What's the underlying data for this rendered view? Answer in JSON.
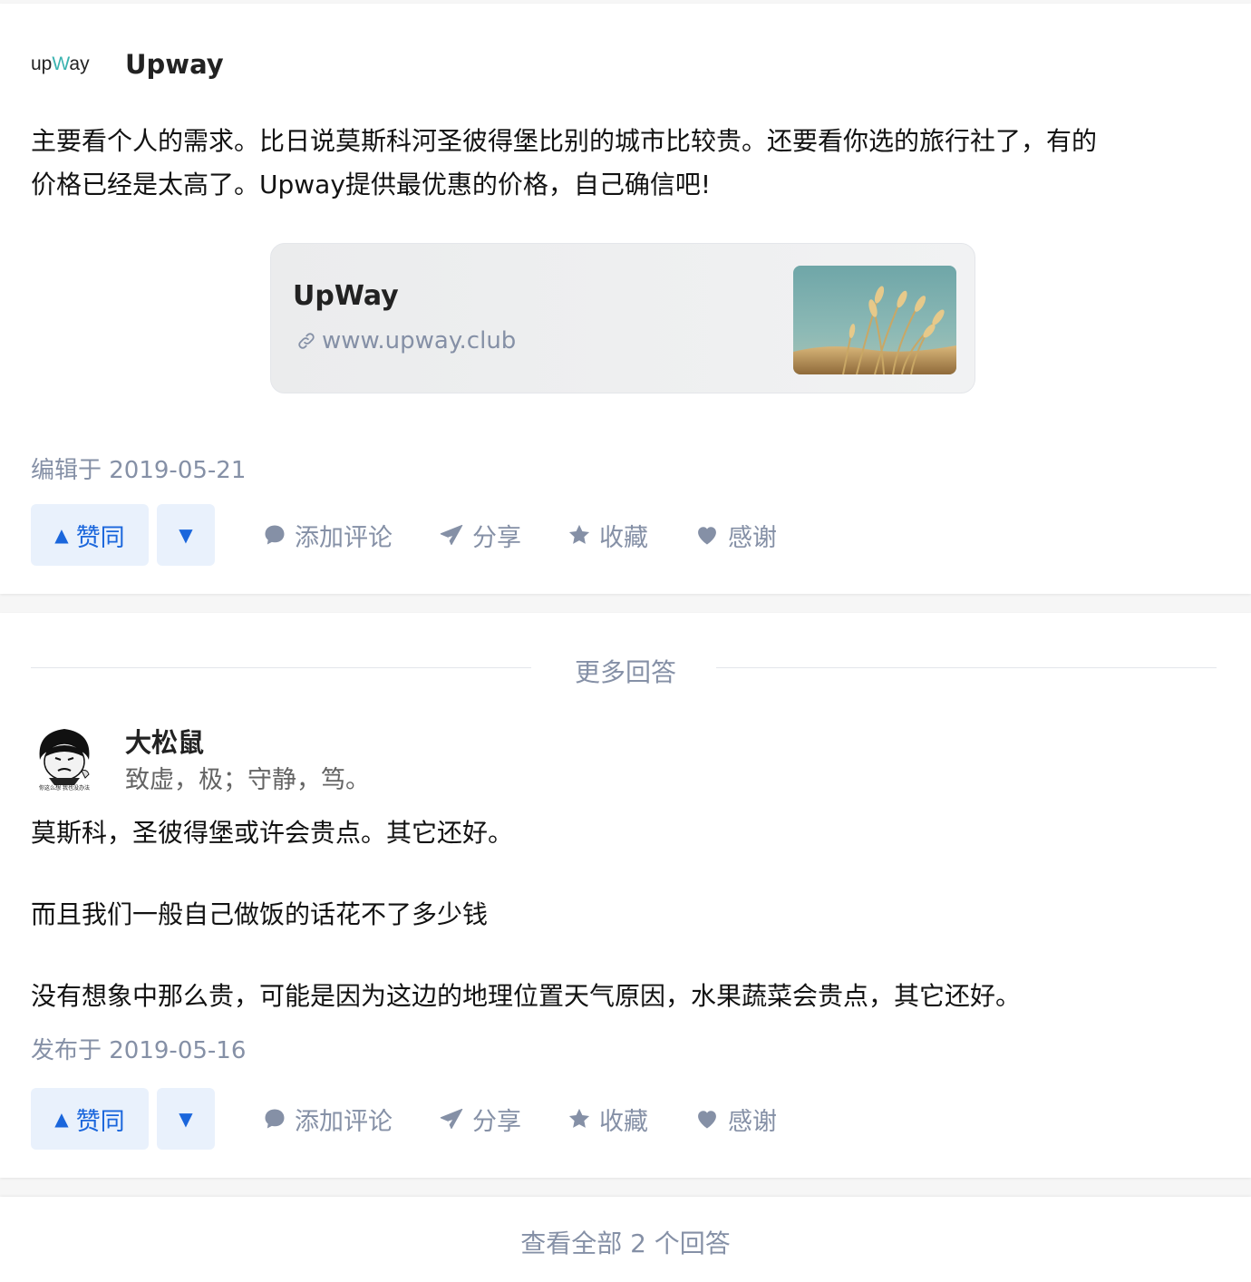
{
  "answer1": {
    "logo_text_left": "up",
    "logo_text_w": "W",
    "logo_text_right": "ay",
    "author_name": "Upway",
    "content_line1": "主要看个人的需求。比日说莫斯科河圣彼得堡比别的城市比较贵。还要看你选的旅行社了，有的",
    "content_line2": "价格已经是太高了。Upway提供最优惠的价格，自己确信吧!",
    "link_card": {
      "title": "UpWay",
      "url": "www.upway.club"
    },
    "meta": "编辑于 2019-05-21",
    "actions": {
      "upvote": "赞同",
      "comment": "添加评论",
      "share": "分享",
      "collect": "收藏",
      "thanks": "感谢"
    }
  },
  "more_answers_label": "更多回答",
  "answer2": {
    "author_name": "大松鼠",
    "author_bio": "致虚，极；守静，笃。",
    "avatar_caption": "你这么想 我也没办法",
    "paragraphs": [
      "莫斯科，圣彼得堡或许会贵点。其它还好。",
      "而且我们一般自己做饭的话花不了多少钱",
      "没有想象中那么贵，可能是因为这边的地理位置天气原因，水果蔬菜会贵点，其它还好。"
    ],
    "meta": "发布于 2019-05-16",
    "actions": {
      "upvote": "赞同",
      "comment": "添加评论",
      "share": "分享",
      "collect": "收藏",
      "thanks": "感谢"
    }
  },
  "view_all": "查看全部 2 个回答",
  "colors": {
    "accent": "#1a66dc",
    "vote_bg": "#e9f1fc",
    "meta": "#8590a6",
    "logo_w": "#3bb3b0"
  }
}
